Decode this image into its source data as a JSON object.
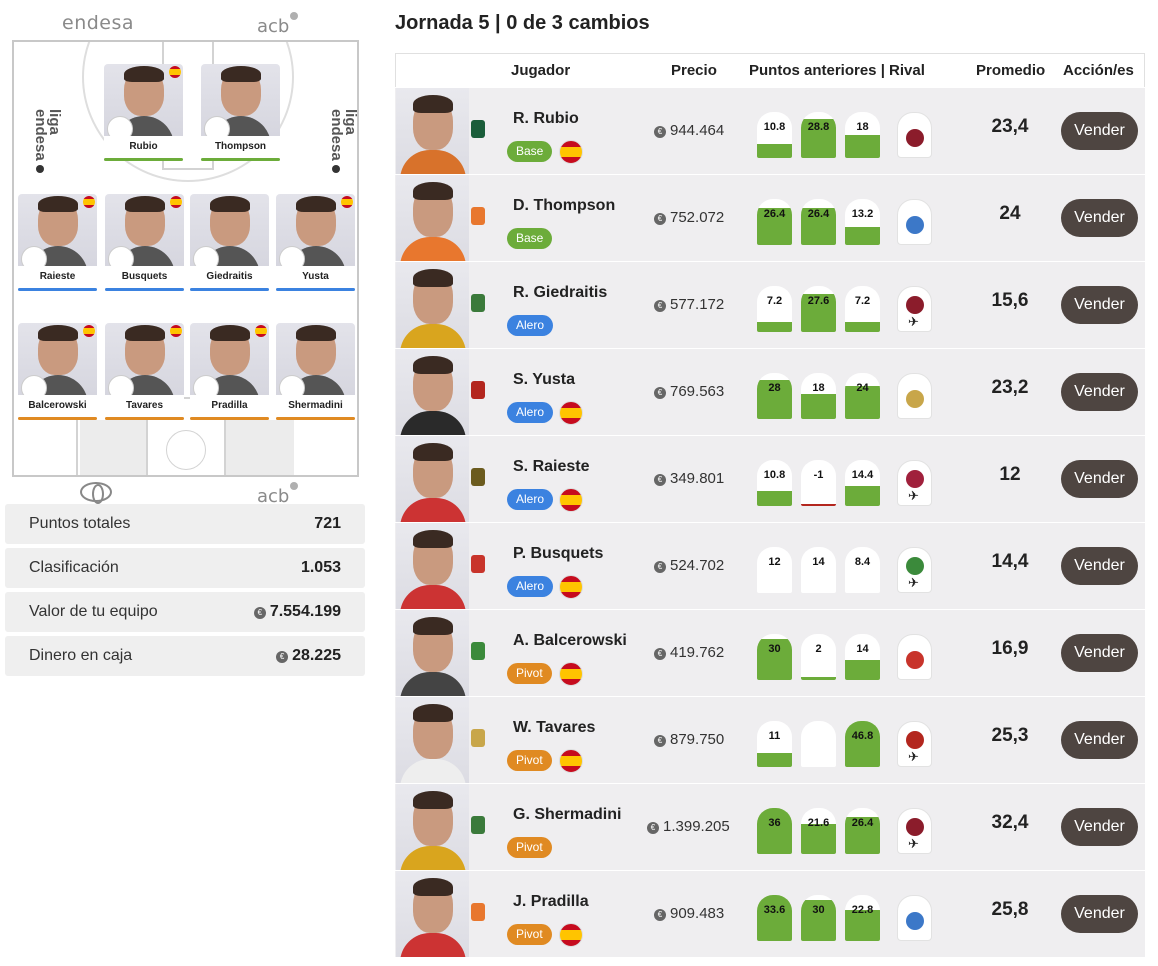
{
  "left": {
    "logos": {
      "top_left": "endesa",
      "top_right": "acb",
      "bottom_right": "acb",
      "court_side": "liga endesa"
    },
    "lineup": [
      {
        "name": "Rubio",
        "bar": "#6cac3a",
        "flag": true,
        "club": "JUV"
      },
      {
        "name": "Thompson",
        "bar": "#6cac3a",
        "flag": false,
        "club": "VBC"
      },
      {
        "name": "Raieste",
        "bar": "#3b82e0",
        "flag": true,
        "club": "UCAM"
      },
      {
        "name": "Busquets",
        "bar": "#3b82e0",
        "flag": true,
        "club": "GIR"
      },
      {
        "name": "Giedraitis",
        "bar": "#3b82e0",
        "flag": false,
        "club": "UNI"
      },
      {
        "name": "Yusta",
        "bar": "#3b82e0",
        "flag": true,
        "club": "BAS"
      },
      {
        "name": "Balcerowski",
        "bar": "#e08a22",
        "flag": true,
        "club": "UNI"
      },
      {
        "name": "Tavares",
        "bar": "#e08a22",
        "flag": true,
        "club": "RM"
      },
      {
        "name": "Pradilla",
        "bar": "#e08a22",
        "flag": true,
        "club": "VBC"
      },
      {
        "name": "Shermadini",
        "bar": "#e08a22",
        "flag": false,
        "club": "LEN"
      }
    ],
    "stats": [
      {
        "label": "Puntos totales",
        "value": "721",
        "coin": false
      },
      {
        "label": "Clasificación",
        "value": "1.053",
        "coin": false
      },
      {
        "label": "Valor de tu equipo",
        "value": "7.554.199",
        "coin": true
      },
      {
        "label": "Dinero en caja",
        "value": "28.225",
        "coin": true
      }
    ]
  },
  "title": "Jornada 5 | 0 de 3 cambios",
  "columns": {
    "player": "Jugador",
    "price": "Precio",
    "points": "Puntos anteriores | Rival",
    "average": "Promedio",
    "actions": "Acción/es"
  },
  "sell_label": "Vender",
  "players": [
    {
      "name": "R. Rubio",
      "position": "Base",
      "pos_color": "#6cac3a",
      "flag": true,
      "price": "944.464",
      "points": [
        "10.8",
        "28.8",
        "18"
      ],
      "fills": [
        0.3,
        0.85,
        0.5
      ],
      "rival_color": "#8b1c2b",
      "away": false,
      "average": "23,4",
      "club_color": "#1a5d3a",
      "shirt": "#d8722b"
    },
    {
      "name": "D. Thompson",
      "position": "Base",
      "pos_color": "#6cac3a",
      "flag": false,
      "price": "752.072",
      "points": [
        "26.4",
        "26.4",
        "13.2"
      ],
      "fills": [
        0.8,
        0.8,
        0.4
      ],
      "rival_color": "#3c78c8",
      "away": false,
      "average": "24",
      "club_color": "#e8772e",
      "shirt": "#e8772e"
    },
    {
      "name": "R. Giedraitis",
      "position": "Alero",
      "pos_color": "#3b82e0",
      "flag": false,
      "price": "577.172",
      "points": [
        "7.2",
        "27.6",
        "7.2"
      ],
      "fills": [
        0.22,
        0.82,
        0.22
      ],
      "rival_color": "#8b1c2b",
      "away": true,
      "average": "15,6",
      "club_color": "#3b7a3b",
      "shirt": "#d9a51e"
    },
    {
      "name": "S. Yusta",
      "position": "Alero",
      "pos_color": "#3b82e0",
      "flag": true,
      "price": "769.563",
      "points": [
        "28",
        "18",
        "24"
      ],
      "fills": [
        0.85,
        0.55,
        0.72
      ],
      "rival_color": "#c8a64a",
      "away": false,
      "average": "23,2",
      "club_color": "#b3261e",
      "shirt": "#2a2a2a"
    },
    {
      "name": "S. Raieste",
      "position": "Alero",
      "pos_color": "#3b82e0",
      "flag": true,
      "price": "349.801",
      "points": [
        "10.8",
        "-1",
        "14.4"
      ],
      "fills": [
        0.33,
        0,
        0.44
      ],
      "neg": [
        false,
        true,
        false
      ],
      "rival_color": "#a0203c",
      "away": true,
      "average": "12",
      "club_color": "#6b5b1e",
      "shirt": "#c33"
    },
    {
      "name": "P. Busquets",
      "position": "Alero",
      "pos_color": "#3b82e0",
      "flag": true,
      "price": "524.702",
      "points": [
        "12",
        "14",
        "8.4"
      ],
      "fills": [
        0.0,
        0.0,
        0.0
      ],
      "rival_color": "#3b8a3b",
      "away": true,
      "average": "14,4",
      "club_color": "#c8342b",
      "shirt": "#c33"
    },
    {
      "name": "A. Balcerowski",
      "position": "Pivot",
      "pos_color": "#e08a22",
      "flag": true,
      "price": "419.762",
      "points": [
        "30",
        "2",
        "14"
      ],
      "fills": [
        0.9,
        0.06,
        0.43
      ],
      "rival_color": "#c8342b",
      "away": false,
      "average": "16,9",
      "club_color": "#3b8a3b",
      "shirt": "#444"
    },
    {
      "name": "W. Tavares",
      "position": "Pivot",
      "pos_color": "#e08a22",
      "flag": true,
      "price": "879.750",
      "points": [
        "11",
        "",
        "46.8"
      ],
      "fills": [
        0.3,
        0,
        1.0
      ],
      "rival_color": "#b3261e",
      "away": true,
      "average": "25,3",
      "club_color": "#c8a64a",
      "shirt": "#eeeeee"
    },
    {
      "name": "G. Shermadini",
      "position": "Pivot",
      "pos_color": "#e08a22",
      "flag": false,
      "price": "1.399.205",
      "points": [
        "36",
        "21.6",
        "26.4"
      ],
      "fills": [
        1.0,
        0.65,
        0.8
      ],
      "rival_color": "#8b1c2b",
      "away": true,
      "average": "32,4",
      "club_color": "#3b7a3b",
      "shirt": "#d9a51e",
      "wide": true
    },
    {
      "name": "J. Pradilla",
      "position": "Pivot",
      "pos_color": "#e08a22",
      "flag": true,
      "price": "909.483",
      "points": [
        "33.6",
        "30",
        "22.8"
      ],
      "fills": [
        1.0,
        0.9,
        0.68
      ],
      "rival_color": "#3c78c8",
      "away": false,
      "average": "25,8",
      "club_color": "#e8772e",
      "shirt": "#c33"
    }
  ]
}
